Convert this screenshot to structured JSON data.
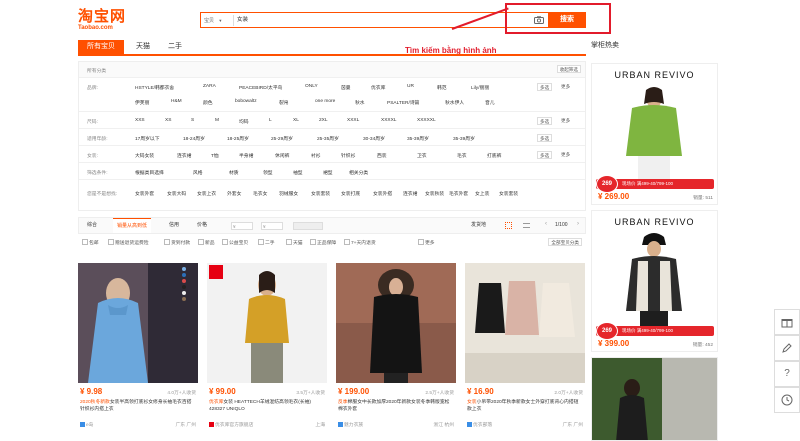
{
  "logo": {
    "cn": "淘宝网",
    "en": "Taobao.com"
  },
  "search": {
    "scope": "宝贝",
    "query": "女装",
    "button": "搜索"
  },
  "annotation": "Tìm kiếm bằng hình ảnh",
  "tabs": [
    "所有宝贝",
    "天猫",
    "二手"
  ],
  "filters": {
    "all_label": "所有分类",
    "collapse_label": "收起筛选",
    "rows": [
      {
        "label": "品牌:",
        "items": [
          "HSTYLE/韩都衣舍",
          "ZARA",
          "PEACEBIRD/太平鸟",
          "ONLY",
          "茵曼",
          "优衣库",
          "UR",
          "韩范",
          "Lily/丽丽",
          "伊芙丽",
          "H&M",
          "颜色",
          "bobowaltz",
          "裂帛",
          "one more",
          "秋水",
          "PSALTER/诗篇",
          "秋水伊人",
          "音儿"
        ],
        "multi": "多选",
        "more": "更多"
      },
      {
        "label": "尺码:",
        "items": [
          "XXS",
          "XS",
          "S",
          "M",
          "均码",
          "L",
          "XL",
          "2XL",
          "XXXL",
          "XXXXL",
          "XXXXXL"
        ],
        "multi": "多选",
        "more": "更多"
      },
      {
        "label": "适用年龄:",
        "items": [
          "17周岁以下",
          "18-24周岁",
          "18-25周岁",
          "25-29周岁",
          "25-35周岁",
          "30-34周岁",
          "35-39周岁",
          "35-39周岁"
        ],
        "multi": "多选",
        "more": ""
      },
      {
        "label": "女装:",
        "items": [
          "大码女装",
          "连衣裙",
          "T恤",
          "半身裙",
          "休闲裤",
          "衬衫",
          "针织衫",
          "西装",
          "卫衣",
          "毛衣",
          "打底裤"
        ],
        "multi": "多选",
        "more": "更多"
      },
      {
        "label": "筛选条件:",
        "items": [
          "根据类目选择",
          "风格",
          "材质",
          "领型",
          "袖型",
          "裙型",
          "相关分类"
        ],
        "multi": "",
        "more": ""
      },
      {
        "label": "您是不是想找:",
        "items": [
          "女装外套",
          "女装大码",
          "女装上衣",
          "外套女",
          "毛衣女",
          "羽绒服女",
          "女装套装",
          "女装打底",
          "女装外搭",
          "连衣裙",
          "女装秋装",
          "毛衣外套",
          "女上装",
          "女装套装"
        ],
        "multi": "",
        "more": ""
      }
    ]
  },
  "sortbar": {
    "items": [
      "综合",
      "销量从高到低",
      "信用",
      "价格"
    ],
    "price_from": "¥",
    "price_to": "¥",
    "ship_from": "发货地",
    "page": "1/100"
  },
  "options": [
    "包邮",
    "赠送退货运费险",
    "货到付款",
    "新品",
    "公益宝贝",
    "二手",
    "天猫",
    "正品保障",
    "7+天内退货",
    "更多"
  ],
  "options_right": "全部宝贝分类",
  "products": [
    {
      "price": "¥ 9.98",
      "sales": "4.0万+人收货",
      "title_hl": "2020秋冬新款",
      "title": "女装半高领打底衫女修身长袖毛衣百搭针织衫内搭上衣",
      "shop": "e岛",
      "loc": "广东 广州",
      "colors": [
        "#7bb0e6",
        "#2c6fb8",
        "#d94b4b",
        "#222",
        "#eee",
        "#8a6e53"
      ]
    },
    {
      "price": "¥ 99.00",
      "sales": "3.5万+人收货",
      "title_hl": "优衣库",
      "title": "女装 HEATTECH羊绒混纺高领毛衣(长袖) 428327 UNIQLO",
      "shop": "优衣库官方旗舰店",
      "loc": "上海"
    },
    {
      "price": "¥ 199.00",
      "sales": "2.5万+人收货",
      "title_hl": "反季",
      "title": "棉服女中长款加厚2020年新款女装冬季韩版宽松棉衣外套",
      "shop": "魅力衣族",
      "loc": "浙江 杭州"
    },
    {
      "price": "¥ 16.90",
      "sales": "2.0万+人收货",
      "title_hl": "女装",
      "title": "小吊带2020年秋季新款女士外穿打底背心内搭短款上衣",
      "shop": "优衣部落",
      "loc": "广东 广州"
    }
  ],
  "side": {
    "title": "掌柜热卖",
    "cards": [
      {
        "brand": "URBAN REVIVO",
        "badge_price": "269",
        "badge_text": "现场价 满499-40/799-100",
        "price": "¥ 269.00",
        "sales": "销量: 511"
      },
      {
        "brand": "URBAN REVIVO",
        "badge_price": "269",
        "badge_text": "现场价 满499-40/799-100",
        "price": "¥ 399.00",
        "sales": "销量: 452"
      }
    ]
  },
  "tools": [
    "gift-icon",
    "edit-icon",
    "help-icon",
    "clock-icon"
  ]
}
